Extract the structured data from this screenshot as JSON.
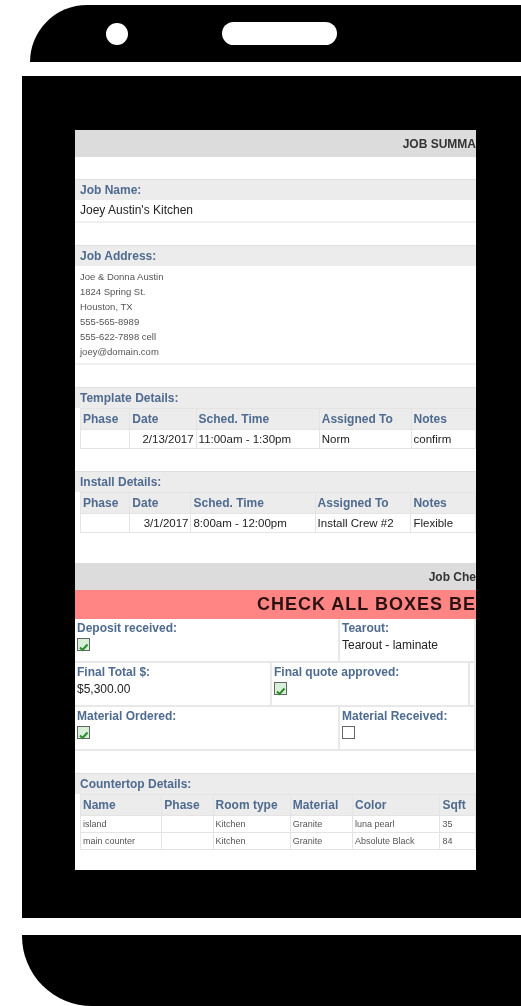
{
  "title": "JOB SUMMA",
  "job_name": {
    "label": "Job Name:",
    "value": "Joey Austin's Kitchen"
  },
  "job_address": {
    "label": "Job Address:",
    "lines": [
      "Joe & Donna Austin",
      "1824 Spring St.",
      "Houston, TX",
      "555-565-8989",
      "555-622-7898 cell",
      "joey@domain.com"
    ]
  },
  "tables": [
    {
      "label": "Template Details:",
      "columns": [
        "Phase",
        "Date",
        "Sched. Time",
        "Assigned To",
        "Notes"
      ],
      "rows": [
        [
          "",
          "2/13/2017",
          "11:00am - 1:30pm",
          "Norm",
          "confirm"
        ]
      ]
    },
    {
      "label": "Install Details:",
      "columns": [
        "Phase",
        "Date",
        "Sched. Time",
        "Assigned To",
        "Notes"
      ],
      "rows": [
        [
          "",
          "3/1/2017",
          "8:00am - 12:00pm",
          "Install Crew #2",
          "Flexible"
        ]
      ]
    }
  ],
  "checklist": {
    "title": "Job Che",
    "banner": "CHECK ALL BOXES BE",
    "rows": [
      {
        "cells": [
          {
            "kind": "checkbox",
            "label": "Deposit received:",
            "checked": true
          },
          {
            "kind": "text",
            "label": "Tearout:",
            "value": "Tearout - laminate"
          }
        ]
      },
      {
        "cells": [
          {
            "kind": "text",
            "label": "Final Total $:",
            "value": "$5,300.00"
          },
          {
            "kind": "checkbox",
            "label": "Final quote approved:",
            "checked": true
          }
        ]
      },
      {
        "cells": [
          {
            "kind": "checkbox",
            "label": "Material Ordered:",
            "checked": true
          },
          {
            "kind": "checkbox",
            "label": "Material Received:",
            "checked": false
          }
        ]
      }
    ]
  },
  "countertop": {
    "label": "Countertop Details:",
    "columns": [
      "Name",
      "Phase",
      "Room type",
      "Material",
      "Color",
      "Sqft"
    ],
    "rows": [
      [
        "island",
        "",
        "Kitchen",
        "Granite",
        "luna pearl",
        "35"
      ],
      [
        "main counter",
        "",
        "Kitchen",
        "Granite",
        "Absolute Black",
        "84"
      ]
    ]
  }
}
